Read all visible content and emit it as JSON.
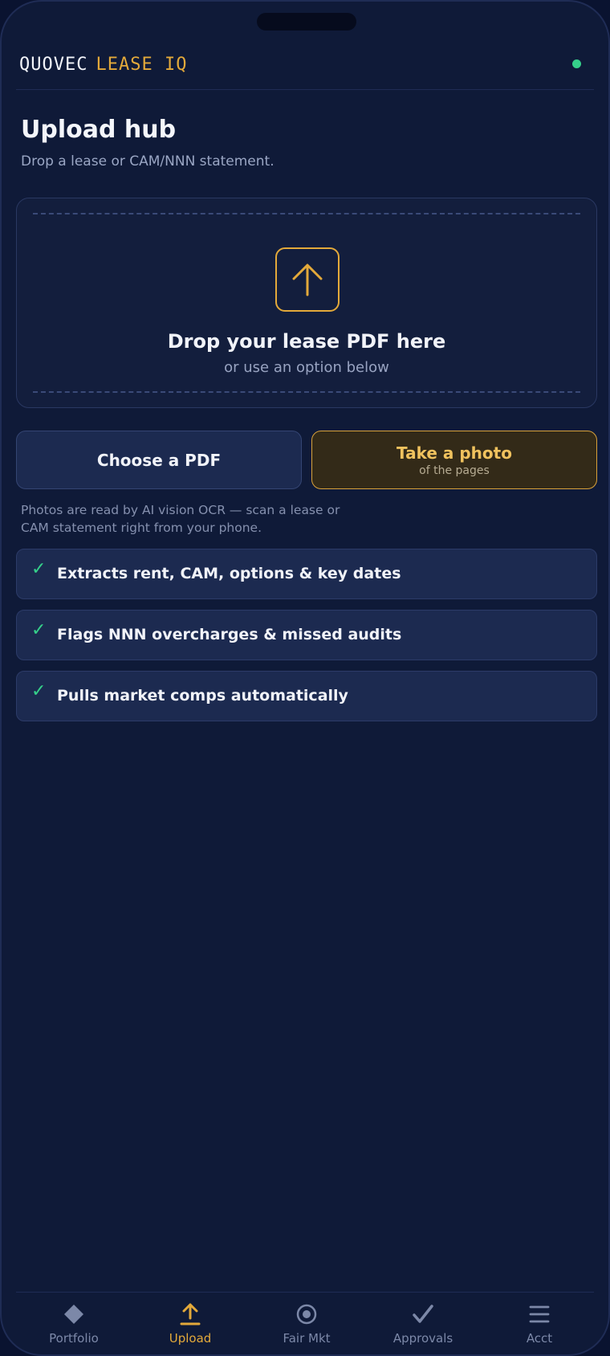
{
  "app": {
    "logo_primary": "QUOVEC",
    "logo_accent": "LEASE IQ",
    "status": "online"
  },
  "page": {
    "title": "Upload hub",
    "subtitle": "Drop a lease or CAM/NNN statement."
  },
  "dropzone": {
    "icon": "upload-arrow-icon",
    "title": "Drop your lease PDF here",
    "subtitle": "or use an option below"
  },
  "actions": {
    "choose_pdf_label": "Choose a PDF",
    "take_photo_label": "Take a photo",
    "take_photo_sublabel": "of the pages"
  },
  "note": "Photos are read by AI vision OCR — scan a lease or CAM statement right from your phone.",
  "features": [
    {
      "check": "✓",
      "text": "Extracts rent, CAM, options & key dates"
    },
    {
      "check": "✓",
      "text": "Flags NNN overcharges & missed audits"
    },
    {
      "check": "✓",
      "text": "Pulls market comps automatically"
    }
  ],
  "tabs": [
    {
      "label": "Portfolio",
      "icon": "diamond-icon"
    },
    {
      "label": "Upload",
      "icon": "upload-icon",
      "active": true
    },
    {
      "label": "Fair Mkt",
      "icon": "target-icon"
    },
    {
      "label": "Approvals",
      "icon": "check-icon"
    },
    {
      "label": "Acct",
      "icon": "menu-icon"
    }
  ],
  "colors": {
    "background": "#0f1a38",
    "accent_gold": "#e3a93a",
    "success_green": "#35d08a",
    "card": "#1c2a50"
  }
}
